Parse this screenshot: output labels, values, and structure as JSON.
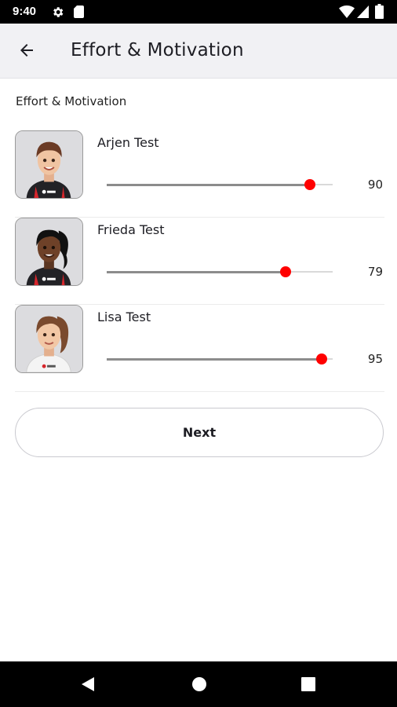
{
  "status_bar": {
    "time": "9:40",
    "icons": [
      "gear-icon",
      "sd-card-icon",
      "wifi-icon",
      "signal-icon",
      "battery-icon"
    ]
  },
  "app_bar": {
    "back_icon": "arrow-left-icon",
    "title": "Effort & Motivation"
  },
  "section": {
    "label": "Effort & Motivation"
  },
  "players": [
    {
      "name": "Arjen Test",
      "value": "90",
      "fraction": 0.9,
      "avatar": "avatar-male-dark-shirt"
    },
    {
      "name": "Frieda Test",
      "value": "79",
      "fraction": 0.79,
      "avatar": "avatar-female-dark-shirt"
    },
    {
      "name": "Lisa Test",
      "value": "95",
      "fraction": 0.95,
      "avatar": "avatar-female-white-shirt"
    }
  ],
  "next_button": {
    "label": "Next"
  },
  "nav_bar": {
    "icons": [
      "nav-back-icon",
      "nav-home-icon",
      "nav-recents-icon"
    ]
  },
  "colors": {
    "accent": "#ff0000",
    "app_bar_bg": "#f1f1f4",
    "slider_fill": "#8c8c8c",
    "slider_track": "#d9d9d9"
  }
}
